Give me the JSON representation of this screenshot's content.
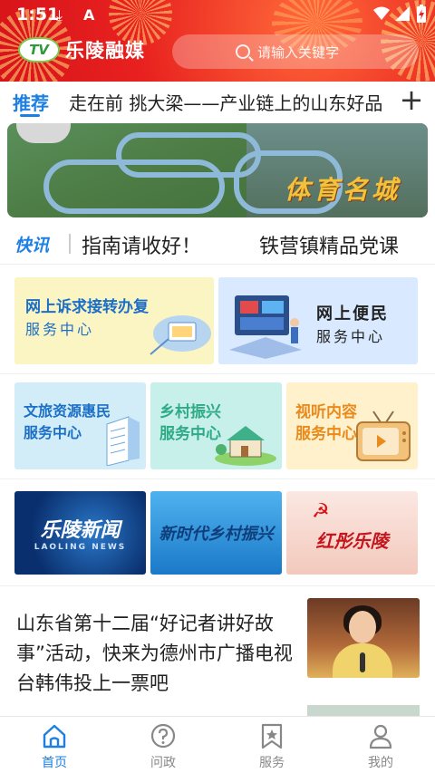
{
  "statusbar": {
    "time": "1:51",
    "icons": [
      "download-icon",
      "app-notification-icon",
      "wifi-icon",
      "signal-icon",
      "battery-charging-icon"
    ]
  },
  "header": {
    "logo_text": "TV",
    "brand_name": "乐陵融媒",
    "search_placeholder": "请输入关键字"
  },
  "tabs": {
    "active": "推荐",
    "scrolling_title": "走在前 挑大梁——产业链上的山东好品",
    "add_label": "+"
  },
  "banner": {
    "caption": "体育名城"
  },
  "news_flash": {
    "label": "快讯",
    "items": [
      "指南请收好！",
      "铁营镇精品党课"
    ]
  },
  "services": [
    {
      "line1": "网上诉求接转办复",
      "line2": "服务中心"
    },
    {
      "line1": "网上便民",
      "line2": "服务中心"
    },
    {
      "line1": "文旅资源惠民",
      "line2": "服务中心"
    },
    {
      "line1": "乡村振兴",
      "line2": "服务中心"
    },
    {
      "line1": "视听内容",
      "line2": "服务中心"
    }
  ],
  "programs": [
    {
      "title": "乐陵新闻",
      "subtitle": "LAOLING NEWS"
    },
    {
      "title": "新时代乡村振兴"
    },
    {
      "title": "红彤乐陵"
    }
  ],
  "article": {
    "title": "山东省第十二届“好记者讲好故事”活动，快来为德州市广播电视台韩伟投上一票吧"
  },
  "bottom_nav": [
    {
      "label": "首页",
      "icon": "home-icon",
      "active": true
    },
    {
      "label": "问政",
      "icon": "question-icon",
      "active": false
    },
    {
      "label": "服务",
      "icon": "star-bookmark-icon",
      "active": false
    },
    {
      "label": "我的",
      "icon": "user-icon",
      "active": false
    }
  ],
  "colors": {
    "header_red": "#e8211f",
    "accent_blue": "#1c7fe3",
    "service_orange": "#e98a1c",
    "service_green": "#2faa86",
    "service_blue": "#1c6fc7"
  }
}
